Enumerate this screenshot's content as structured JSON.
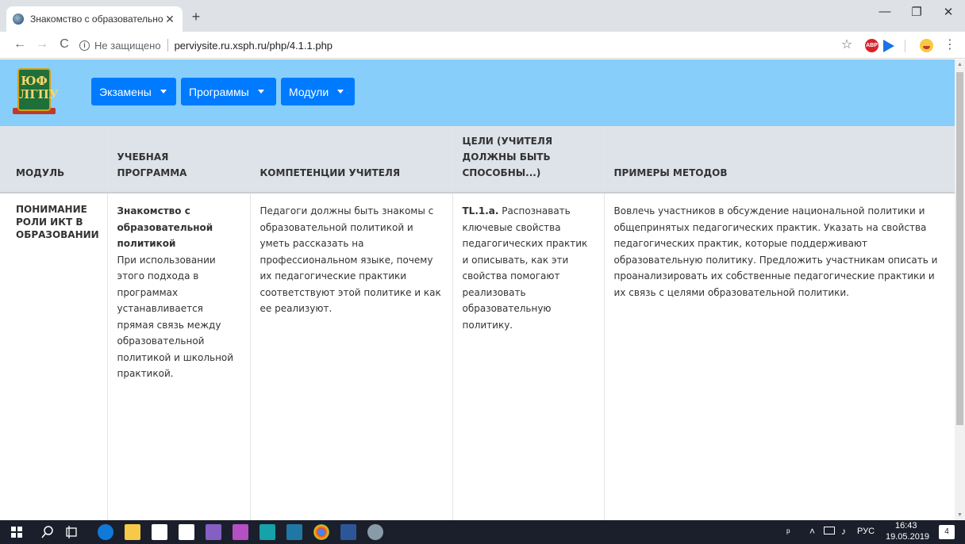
{
  "browser": {
    "tab_title": "Знакомство с образовательной",
    "tab_close": "✕",
    "new_tab": "+",
    "minimize": "—",
    "restore": "❐",
    "close": "✕",
    "back": "←",
    "forward": "→",
    "reload": "C",
    "security_label": "Не защищено",
    "url": "perviysite.ru.xsph.ru/php/4.1.1.php",
    "bookmark_star": "☆",
    "abp_label": "ABP",
    "menu_dots": "⋮"
  },
  "site": {
    "logo_text": "ЮФ ЛГПУ",
    "menu": [
      {
        "label": "Экзамены"
      },
      {
        "label": "Программы"
      },
      {
        "label": "Модули"
      }
    ]
  },
  "table": {
    "headers": {
      "module": "МОДУЛЬ",
      "program": "УЧЕБНАЯ ПРОГРАММА",
      "competencies": "КОМПЕТЕНЦИИ УЧИТЕЛЯ",
      "goals": "ЦЕЛИ (УЧИТЕЛЯ ДОЛЖНЫ БЫТЬ СПОСОБНЫ...)",
      "methods": "ПРИМЕРЫ МЕТОДОВ"
    },
    "row": {
      "module": "ПОНИМАНИЕ РОЛИ ИКТ В ОБРАЗОВАНИИ",
      "program_title": "Знакомство с образовательной политикой",
      "program_text": "При использовании этого подхода в программах устанавливается прямая связь между образовательной политикой и школьной практикой.",
      "competencies": "Педагоги должны быть знакомы с образовательной политикой и уметь рассказать на профессиональном языке, почему их педагогические практики соответствуют этой политике и как ее реализуют.",
      "goal_code": "TL.1.a.",
      "goal_text": "Распознавать ключевые свойства педагогических практик и описывать, как эти свойства помогают реализовать образовательную политику.",
      "methods": "Вовлечь участников в обсуждение национальной политики и общепринятых педагогических практик. Указать на свойства педагогических практик, которые поддерживают образовательную политику. Предложить участникам описать и проанализировать их собственные педагогические практики и их связь с целями образовательной политики."
    }
  },
  "taskbar": {
    "language": "РУС",
    "time": "16:43",
    "date": "19.05.2019",
    "notifications": "4"
  }
}
